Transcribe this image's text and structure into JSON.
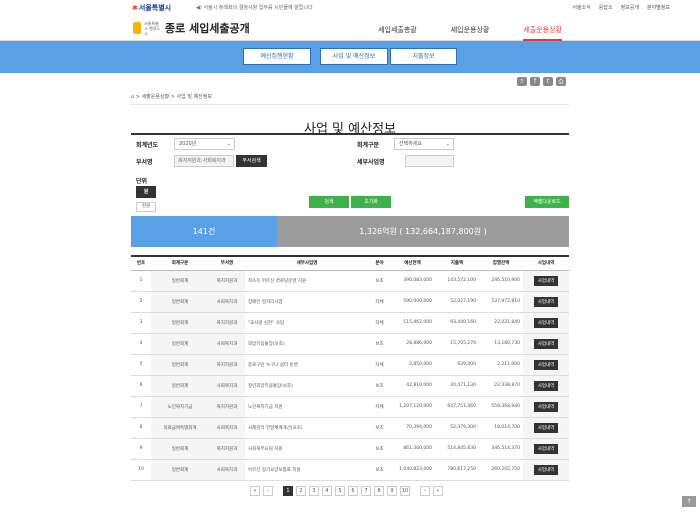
{
  "top": {
    "logo": "서울특별시",
    "notice": "서울시 정례회의 결정사항 업무를 시민들께 알립니다",
    "links": [
      "서울소식",
      "응답소",
      "정보공개",
      "분야별정보"
    ]
  },
  "header": {
    "brand_small": "서울특별시 행정도시",
    "brand": "종로 세입세출공개",
    "nav": [
      {
        "label": "세입세출총괄",
        "active": false
      },
      {
        "label": "세입운용상황",
        "active": false
      },
      {
        "label": "세출운용상황",
        "active": true
      }
    ]
  },
  "subnav": [
    "예산집행현황",
    "사업 및 예산정보",
    "지출정보"
  ],
  "sns_icons": [
    "share-icon",
    "facebook-icon",
    "twitter-icon",
    "print-icon"
  ],
  "breadcrumb": [
    "세출운용상황",
    "사업 및 예산정보"
  ],
  "page_title": "사업 및 예산정보",
  "filters": {
    "year_label": "회계년도",
    "year_value": "2020년",
    "account_label": "회계구분",
    "account_value": "선택하세요",
    "dept_label": "부서명",
    "dept_value": "복지지원과,사회복지과",
    "dept_search": "부서검색",
    "detail_label": "세부사업명",
    "unit_label": "단위",
    "unit_won": "원",
    "unit_thousand": "천원",
    "search": "검색",
    "reset": "초기화",
    "excel": "엑셀다운로드"
  },
  "stats": {
    "count": "141건",
    "amount": "1,326억원 ( 132,664,187,800원 )"
  },
  "table": {
    "headers": [
      "번호",
      "회계구분",
      "부서명",
      "세부사업명",
      "분야",
      "예산현액",
      "지출액",
      "집행잔액",
      "사업내역"
    ],
    "rows": [
      [
        "1",
        "일반회계",
        "복지지원과",
        "저소득 어르신 경로당운영 지원",
        "보조",
        "390,083,000",
        "143,572,100",
        "246,510,900",
        "사업내역"
      ],
      [
        "2",
        "일반회계",
        "사회복지과",
        "장애인 일자리사업",
        "자체",
        "590,000,000",
        "52,027,190",
        "537,972,810",
        "사업내역"
      ],
      [
        "3",
        "일반회계",
        "복지지원과",
        "\"효사랑 실천\" 사업",
        "자체",
        "115,462,000",
        "93,440,160",
        "22,021,840",
        "사업내역"
      ],
      [
        "4",
        "일반회계",
        "사회복지과",
        "희망키움통장(보조)",
        "보조",
        "28,886,000",
        "15,705,270",
        "13,180,730",
        "사업내역"
      ],
      [
        "5",
        "일반회계",
        "복지지원과",
        "종로구민 누구나 쉼터 운영",
        "자체",
        "2,850,000",
        "639,000",
        "2,211,000",
        "사업내역"
      ],
      [
        "6",
        "일반회계",
        "사회복지과",
        "청년희망키움통장(보조)",
        "보조",
        "42,810,000",
        "20,471,130",
        "22,338,870",
        "사업내역"
      ],
      [
        "7",
        "노인복지기금",
        "복지지원과",
        "노인복지기금 지원",
        "자체",
        "1,207,120,000",
        "647,751,060",
        "559,368,940",
        "사업내역"
      ],
      [
        "8",
        "의료급여특별회계",
        "사회복지과",
        "사례관리 전달체계개선(보조)",
        "보조",
        "70,394,000",
        "52,379,300",
        "18,014,700",
        "사업내역"
      ],
      [
        "9",
        "일반회계",
        "복지지원과",
        "사회복무요원 지원",
        "보조",
        "861,360,000",
        "514,845,630",
        "346,514,370",
        "사업내역"
      ],
      [
        "10",
        "일반회계",
        "사회복지과",
        "어르신 장기요양보험료 지원",
        "보조",
        "1,040,823,000",
        "780,617,250",
        "260,205,750",
        "사업내역"
      ]
    ]
  },
  "pager": {
    "first": "«",
    "prev": "‹",
    "pages": [
      "1",
      "2",
      "3",
      "4",
      "5",
      "6",
      "7",
      "8",
      "9",
      "10"
    ],
    "current": "1",
    "next": "›",
    "last": "»"
  },
  "totop": "↑"
}
